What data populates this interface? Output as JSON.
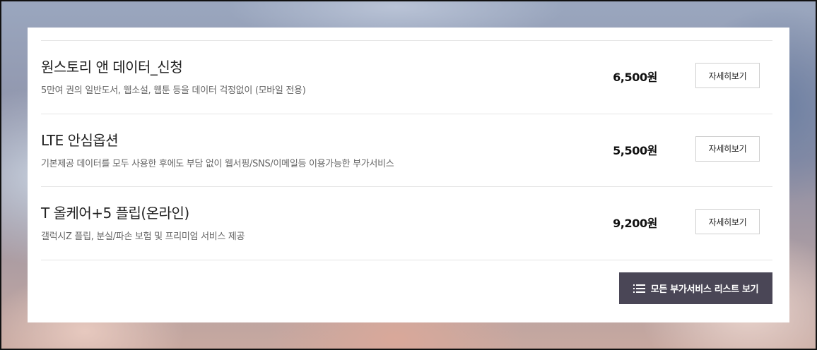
{
  "services": [
    {
      "title": "원스토리 앤 데이터_신청",
      "description": "5만여 권의 일반도서, 웹소설, 웹툰 등을 데이터 걱정없이 (모바일 전용)",
      "price": "6,500원",
      "detail_label": "자세히보기"
    },
    {
      "title": "LTE 안심옵션",
      "description": "기본제공 데이터를 모두 사용한 후에도 부담 없이 웹서핑/SNS/이메일등 이용가능한 부가서비스",
      "price": "5,500원",
      "detail_label": "자세히보기"
    },
    {
      "title": "T 올케어+5 플립(온라인)",
      "description": "갤럭시Z 플립, 분실/파손 보험 및 프리미엄 서비스 제공",
      "price": "9,200원",
      "detail_label": "자세히보기"
    }
  ],
  "all_services_button": {
    "label": "모든 부가서비스 리스트 보기",
    "icon": "list-icon"
  },
  "colors": {
    "button_dark": "#4a4656",
    "card_bg": "#ffffff",
    "divider": "#e4e4e4"
  }
}
